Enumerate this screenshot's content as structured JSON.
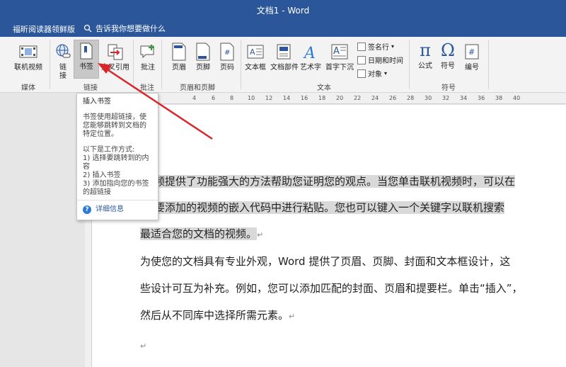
{
  "window": {
    "title": "文档1  -  Word"
  },
  "tabbar": {
    "plugin_tab": "福昕阅读器领鲜版",
    "tell_me": "告诉我你想要做什么"
  },
  "ribbon": {
    "online_video": "联机视频",
    "link": "链\n接",
    "bookmark": "书签",
    "cross_ref": "交叉引用",
    "comment": "批注",
    "header": "页眉",
    "footer": "页脚",
    "page_num": "页码",
    "textbox": "文本框",
    "doc_parts": "文档部件",
    "wordart": "艺术字",
    "dropcap": "首字下沉",
    "signature": "签名行",
    "datetime": "日期和时间",
    "object": "对象",
    "formula": "公式",
    "symbol": "符号",
    "numbering": "编号",
    "groups": {
      "media": "媒体",
      "links": "链接",
      "comments": "批注",
      "header_footer": "页眉和页脚",
      "text": "文本",
      "symbols": "符号"
    }
  },
  "ruler": [
    "4",
    "6",
    "8",
    "10",
    "12",
    "14",
    "16",
    "18",
    "20",
    "22",
    "24",
    "26",
    "28",
    "30",
    "32",
    "34",
    "36",
    "38",
    "40"
  ],
  "tooltip": {
    "title": "插入书签",
    "description": "书签使用超链接，使您能够跳转到文档的特定位置。",
    "how_title": "以下是工作方式:",
    "step1": "1) 选择要跳转到的内容",
    "step2": "2) 插入书签",
    "step3": "3) 添加指向您的书签的超链接",
    "more": "详细信息"
  },
  "document": {
    "line1": "频提供了功能强大的方法帮助您证明您的观点。当您单击联机视频时，可以在",
    "line2": "要添加的视频的嵌入代码中进行粘贴。您也可以键入一个关键字以联机搜索",
    "line3": "最适合您的文档的视频。",
    "line4": "为使您的文档具有专业外观，Word 提供了页眉、页脚、封面和文本框设计，这",
    "line5": "些设计可互为补充。例如，您可以添加匹配的封面、页眉和提要栏。单击“插入”，",
    "line6": "然后从不同库中选择所需元素。",
    "para_mark": "↵"
  },
  "colors": {
    "accent": "#2b579a",
    "arrow": "#d9262b",
    "highlight": "#d9d9d9"
  }
}
